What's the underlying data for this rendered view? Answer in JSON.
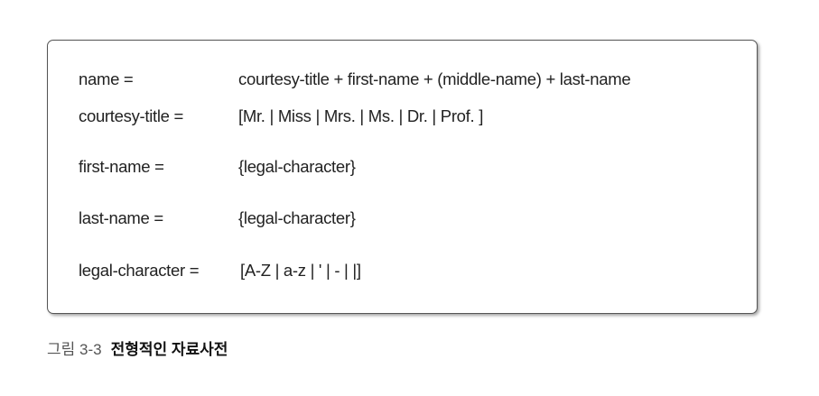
{
  "dictionary": {
    "entries": [
      {
        "term": "name =",
        "definition": "courtesy-title + first-name + (middle-name) + last-name"
      },
      {
        "term": "courtesy-title =",
        "definition": "[Mr. | Miss | Mrs. | Ms. | Dr. | Prof. ]"
      },
      {
        "term": "first-name =",
        "definition": "{legal-character}"
      },
      {
        "term": "last-name =",
        "definition": "{legal-character}"
      },
      {
        "term": "legal-character =",
        "definition": "[A-Z | a-z | ' | - |  |]"
      }
    ]
  },
  "caption": {
    "figure_number": "그림 3-3",
    "title": "전형적인 자료사전"
  }
}
